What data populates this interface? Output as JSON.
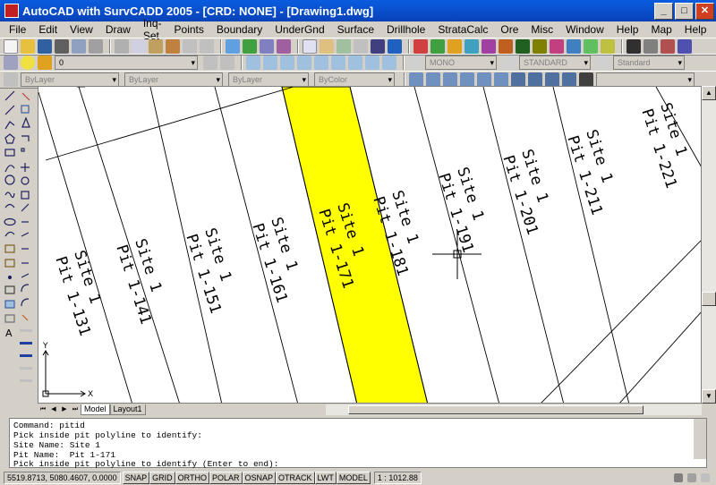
{
  "window": {
    "title": "AutoCAD with SurvCADD 2005 - [CRD: NONE] - [Drawing1.dwg]",
    "min": "_",
    "max": "□",
    "close": "✕"
  },
  "menu": [
    "File",
    "Edit",
    "View",
    "Draw",
    "Inq-Set",
    "Points",
    "Boundary",
    "UnderGnd",
    "Surface",
    "Drillhole",
    "StrataCalc",
    "Ore",
    "Misc",
    "Window",
    "Help",
    "Map",
    "Help"
  ],
  "toolbar": {
    "layer_value": "0",
    "font_combo": "MONO",
    "dim_combo": "STANDARD",
    "table_combo": "Standard",
    "color_combo": "ByLayer",
    "linetype_combo": "ByLayer",
    "lineweight_combo": "ByLayer",
    "plotstyle_combo": "ByColor"
  },
  "drawing": {
    "pits": [
      {
        "site": "Site 1",
        "pit": "Pit 1-131"
      },
      {
        "site": "Site 1",
        "pit": "Pit 1-141"
      },
      {
        "site": "Site 1",
        "pit": "Pit 1-151"
      },
      {
        "site": "Site 1",
        "pit": "Pit 1-161"
      },
      {
        "site": "Site 1",
        "pit": "Pit 1-171"
      },
      {
        "site": "Site 1",
        "pit": "Pit 1-181"
      },
      {
        "site": "Site 1",
        "pit": "Pit 1-191"
      },
      {
        "site": "Site 1",
        "pit": "Pit 1-201"
      },
      {
        "site": "Site 1",
        "pit": "Pit 1-211"
      },
      {
        "site": "Site 1",
        "pit": "Pit 1-221"
      }
    ],
    "highlight_pit": "Pit 1-171",
    "highlight_color": "#ffff00",
    "ucs_x": "X",
    "ucs_y": "Y"
  },
  "tabs": [
    "Model",
    "Layout1"
  ],
  "command": {
    "lines": [
      "Command: pitid",
      "Pick inside pit polyline to identify:",
      "Site Name: Site 1",
      "Pit Name:  Pit 1-171"
    ],
    "prompt": "Pick inside pit polyline to identify (Enter to end):"
  },
  "status": {
    "coords": "5519.8713, 5080.4607, 0.0000",
    "buttons": [
      "SNAP",
      "GRID",
      "ORTHO",
      "POLAR",
      "OSNAP",
      "OTRACK",
      "LWT",
      "MODEL"
    ],
    "scale": "1 : 1012.88"
  }
}
